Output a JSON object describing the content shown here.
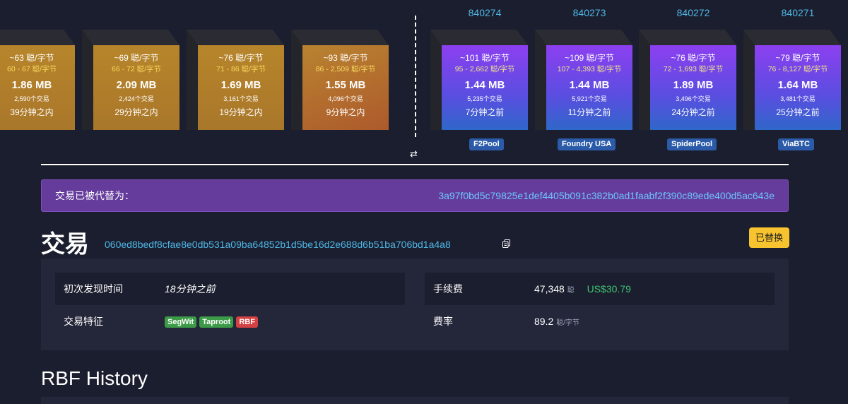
{
  "pending_blocks": [
    {
      "fee": "~63 聪/字节",
      "range": "60 - 67 聪/字节",
      "size": "1.86 MB",
      "txs": "2,590个交易",
      "time": "39分钟之内"
    },
    {
      "fee": "~69 聪/字节",
      "range": "66 - 72 聪/字节",
      "size": "2.09 MB",
      "txs": "2,424个交易",
      "time": "29分钟之内"
    },
    {
      "fee": "~76 聪/字节",
      "range": "71 - 86 聪/字节",
      "size": "1.69 MB",
      "txs": "3,161个交易",
      "time": "19分钟之内"
    },
    {
      "fee": "~93 聪/字节",
      "range": "86 - 2,509 聪/字节",
      "size": "1.55 MB",
      "txs": "4,096个交易",
      "time": "9分钟之内"
    }
  ],
  "mined_blocks": [
    {
      "height": "840274",
      "fee": "~101 聪/字节",
      "range": "95 - 2,662 聪/字节",
      "size": "1.44 MB",
      "txs": "5,235个交易",
      "time": "7分钟之前",
      "pool": "F2Pool"
    },
    {
      "height": "840273",
      "fee": "~109 聪/字节",
      "range": "107 - 4,393 聪/字节",
      "size": "1.44 MB",
      "txs": "5,921个交易",
      "time": "11分钟之前",
      "pool": "Foundry USA"
    },
    {
      "height": "840272",
      "fee": "~76 聪/字节",
      "range": "72 - 1,693 聪/字节",
      "size": "1.89 MB",
      "txs": "3,496个交易",
      "time": "24分钟之前",
      "pool": "SpiderPool"
    },
    {
      "height": "840271",
      "fee": "~79 聪/字节",
      "range": "76 - 8,127 聪/字节",
      "size": "1.64 MB",
      "txs": "3,481个交易",
      "time": "25分钟之前",
      "pool": "ViaBTC"
    }
  ],
  "replaced_banner": {
    "label": "交易已被代替为：",
    "txid": "3a97f0bd5c79825e1def4405b091c382b0ad1faabf2f390c89ede400d5ac643e"
  },
  "transaction": {
    "title": "交易",
    "txid": "060ed8bedf8cfae8e0db531a09ba64852b1d5be16d2e688d6b51ba706bd1a4a8",
    "status_badge": "已替换"
  },
  "details": {
    "first_seen_label": "初次发现时间",
    "first_seen_value": "18分钟之前",
    "features_label": "交易特征",
    "features": [
      {
        "label": "SegWit",
        "color": "#3b9b46"
      },
      {
        "label": "Taproot",
        "color": "#3b9b46"
      },
      {
        "label": "RBF",
        "color": "#d34143"
      }
    ],
    "fee_label": "手续费",
    "fee_value": "47,348",
    "fee_unit": "聪",
    "fee_usd": "US$30.79",
    "feerate_label": "费率",
    "feerate_value": "89.2",
    "feerate_unit": "聪/字节"
  },
  "history_title": "RBF History"
}
